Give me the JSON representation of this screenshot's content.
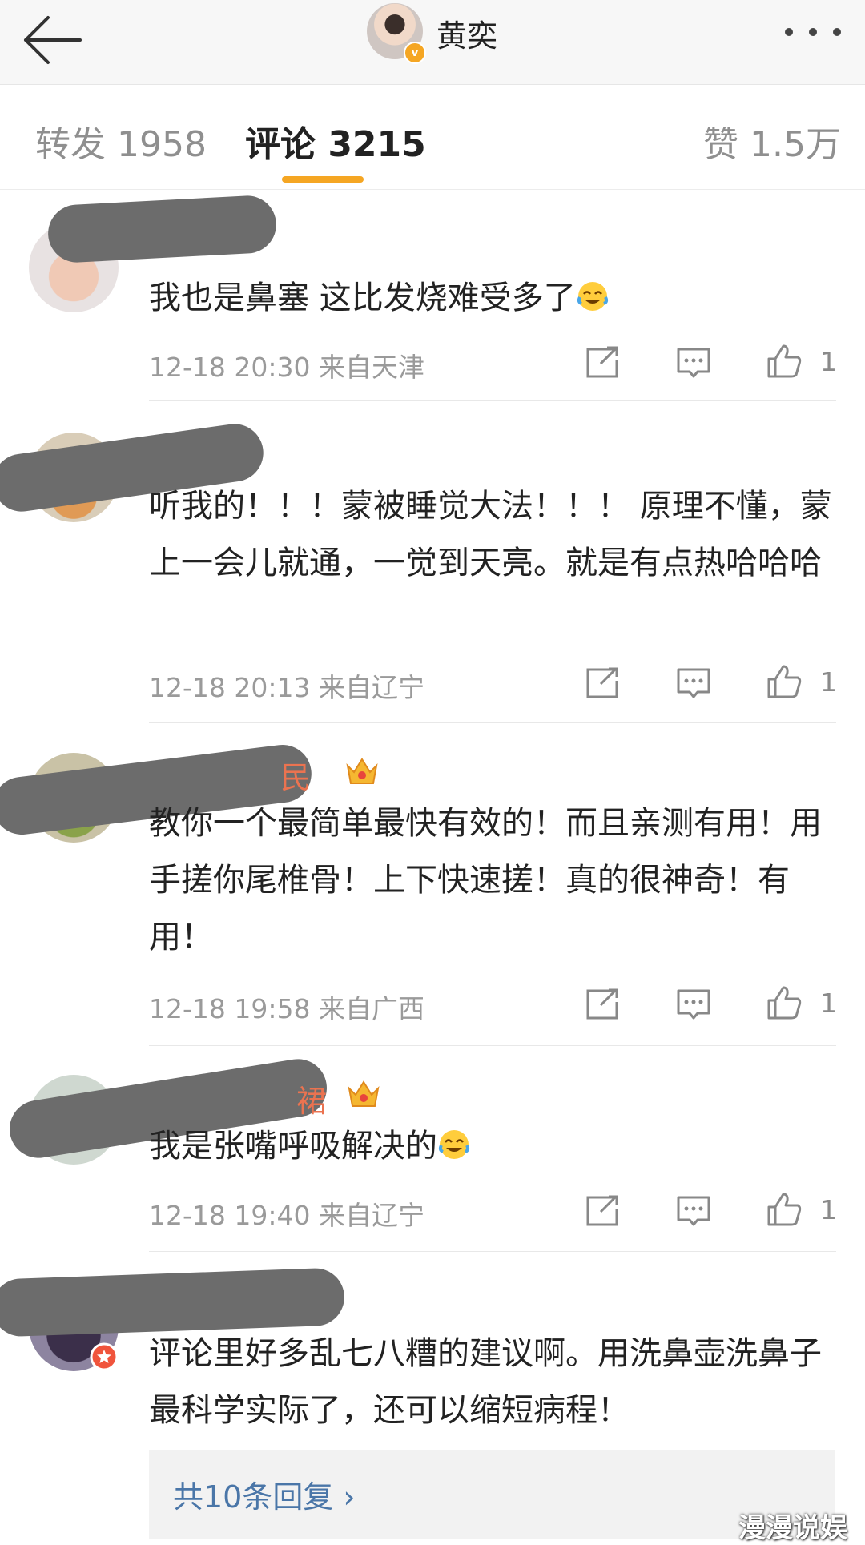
{
  "header": {
    "title": "黄奕"
  },
  "tabs": [
    {
      "label": "转发 1958"
    },
    {
      "label": "评论 3215"
    },
    {
      "label": "赞 1.5万"
    }
  ],
  "comments": [
    {
      "text": "我也是鼻塞 这比发烧难受多了",
      "emoji": "laugh-cry-emoji",
      "time": "12-18 20:30",
      "location": "来自天津",
      "likes": "1"
    },
    {
      "text": "听我的！！！蒙被睡觉大法！！！ 原理不懂，蒙上一会儿就通，一觉到天亮。就是有点热哈哈哈",
      "time": "12-18 20:13",
      "location": "来自辽宁",
      "likes": "1"
    },
    {
      "username_partial": "民",
      "text": "教你一个最简单最快有效的！而且亲测有用！用手搓你尾椎骨！上下快速搓！真的很神奇！有用！",
      "time": "12-18 19:58",
      "location": "来自广西",
      "likes": "1"
    },
    {
      "username_partial": "裙",
      "text": "我是张嘴呼吸解决的",
      "emoji": "laugh-cry-emoji",
      "time": "12-18 19:40",
      "location": "来自辽宁",
      "likes": "1"
    },
    {
      "text": "评论里好多乱七八糟的建议啊。用洗鼻壶洗鼻子最科学实际了，还可以缩短病程！",
      "reply_link": "共10条回复 ›"
    }
  ],
  "watermark": "漫漫说娱",
  "colors": {
    "accent": "#f5a623",
    "username": "#eb7350",
    "link": "#4a76a8",
    "meta": "#9a9a9a"
  }
}
